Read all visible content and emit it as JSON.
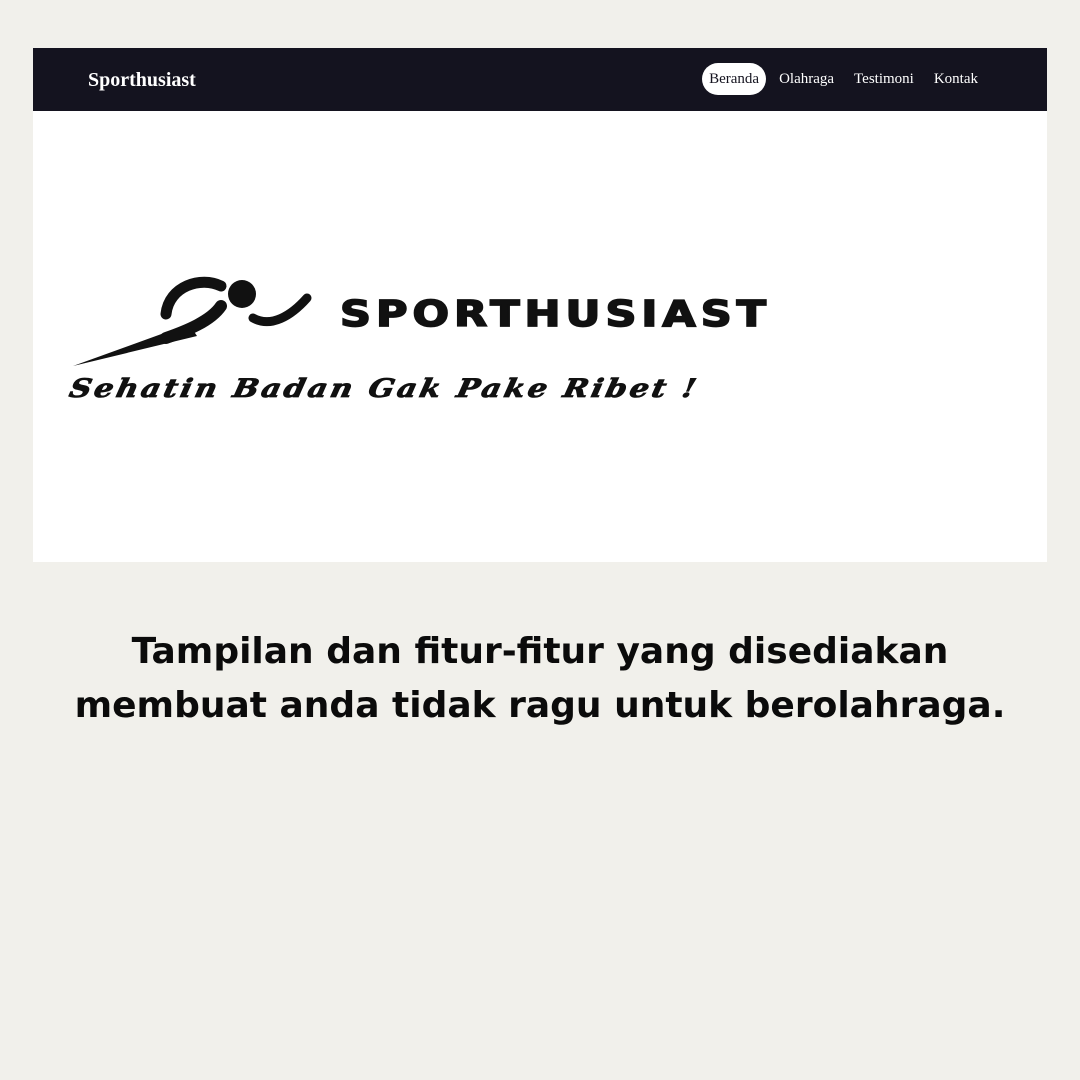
{
  "navbar": {
    "brand": "Sporthusiast",
    "links": [
      {
        "label": "Beranda",
        "active": true
      },
      {
        "label": "Olahraga",
        "active": false
      },
      {
        "label": "Testimoni",
        "active": false
      },
      {
        "label": "Kontak",
        "active": false
      }
    ]
  },
  "hero": {
    "logo_text": "SPORTHUSIAST",
    "tagline": "Sehatin Badan Gak Pake Ribet !",
    "logo_icon": "runner-icon"
  },
  "caption": {
    "line1": "Tampilan dan fitur-fitur yang disediakan",
    "line2": "membuat anda tidak ragu untuk berolahraga."
  },
  "colors": {
    "page_background": "#f1f0eb",
    "navbar_background": "#14131f",
    "active_pill": "#ffffff"
  }
}
